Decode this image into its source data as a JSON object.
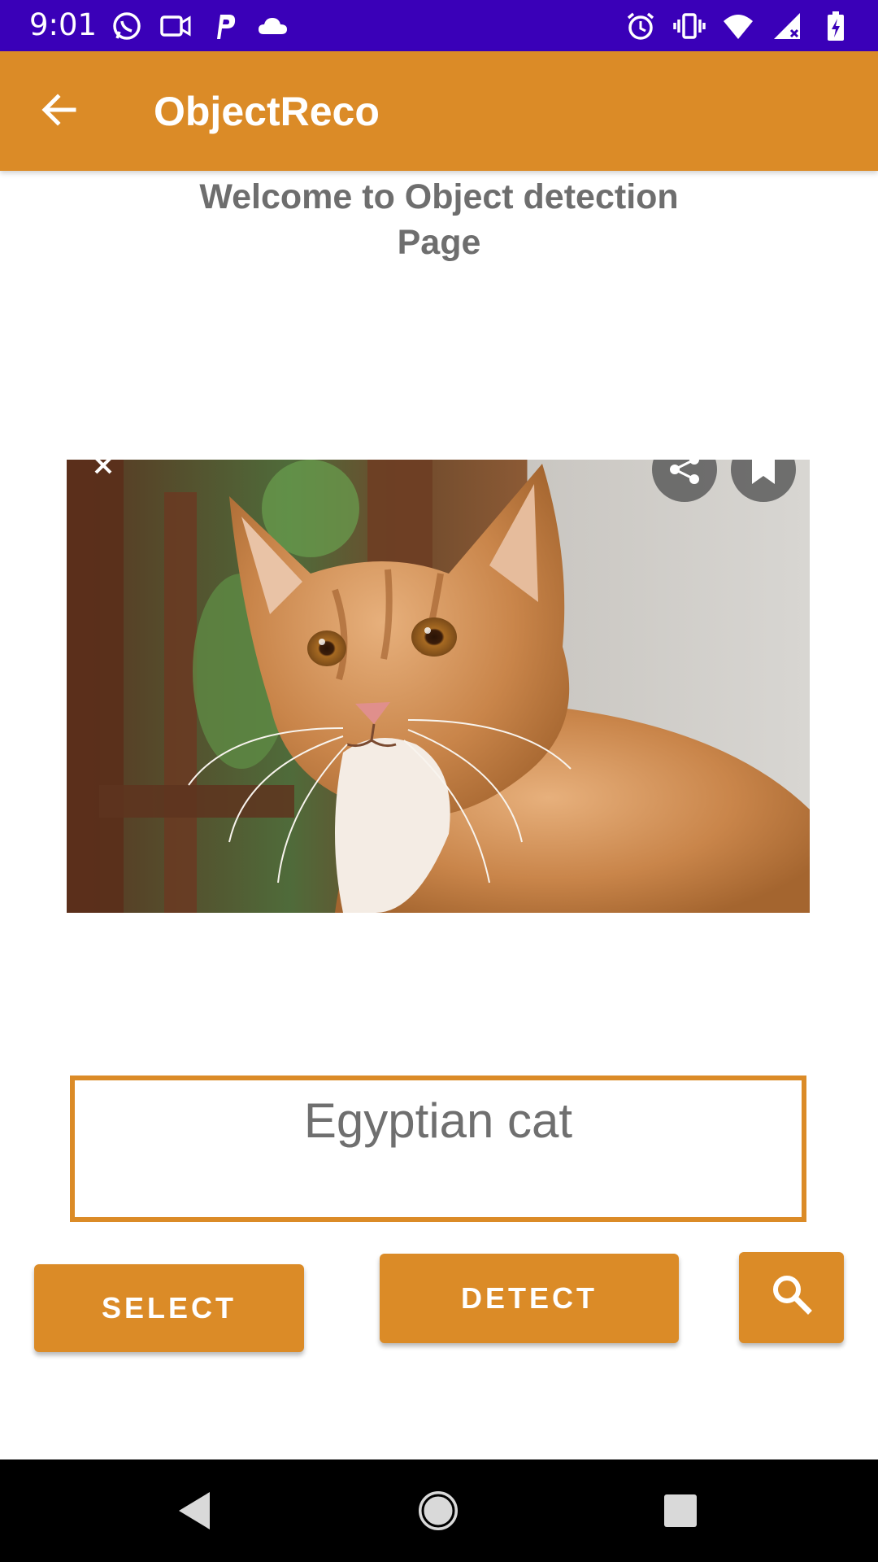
{
  "status_bar": {
    "time": "9:01",
    "left_icons": [
      "whatsapp-icon",
      "video-call-icon",
      "paytm-icon",
      "cloud-icon"
    ],
    "right_icons": [
      "alarm-icon",
      "vibrate-icon",
      "wifi-icon",
      "signal-icon",
      "battery-charging-icon"
    ]
  },
  "app_bar": {
    "title": "ObjectReco",
    "back_icon": "arrow-back-icon",
    "color": "#db8b27"
  },
  "main": {
    "welcome_text": "Welcome to Object detection\nPage",
    "image": {
      "subject": "orange tabby cat",
      "overlay_icons": [
        "close-icon",
        "share-icon",
        "bookmark-icon"
      ]
    },
    "result_text": "Egyptian cat",
    "buttons": {
      "select_label": "SELECT",
      "detect_label": "DETECT",
      "search_icon": "search-icon"
    }
  },
  "nav_bar": {
    "icons": [
      "back-triangle-icon",
      "home-circle-icon",
      "recents-square-icon"
    ]
  },
  "colors": {
    "status_bar": "#3a00b8",
    "accent": "#db8b27",
    "text_gray": "#6e6e6e"
  }
}
